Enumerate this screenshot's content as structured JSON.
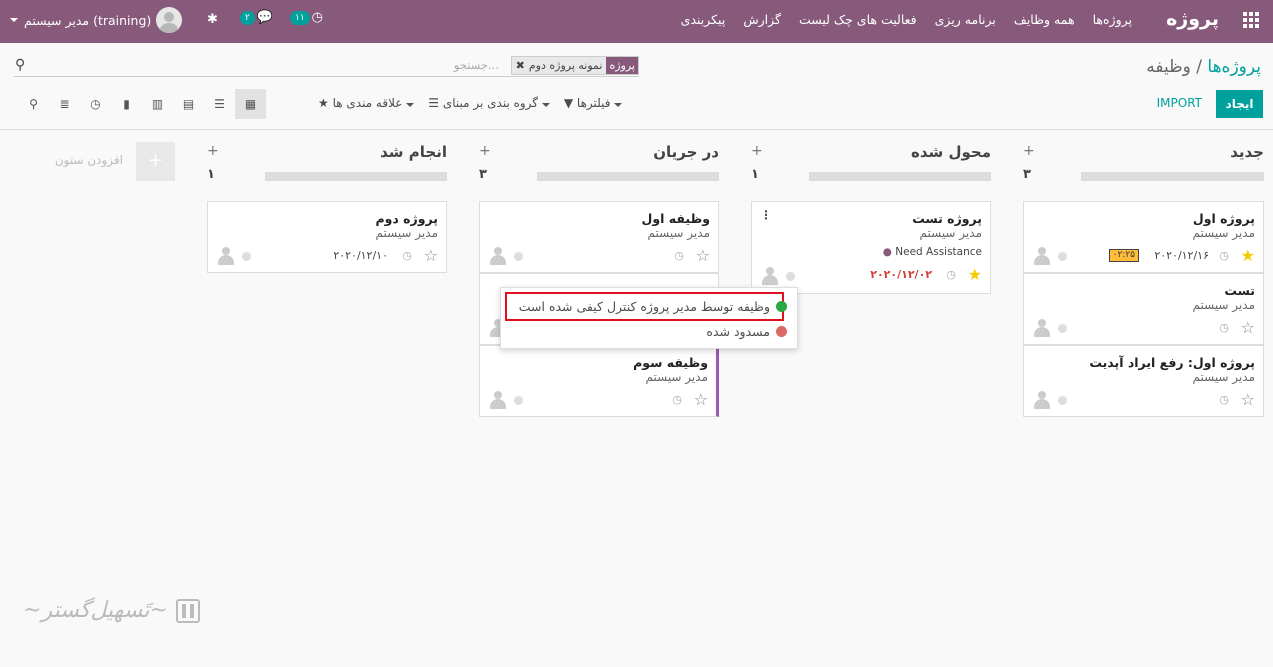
{
  "topbar": {
    "app_name": "پروژه",
    "menu": [
      "پروژه‌ها",
      "همه وظایف",
      "برنامه ریزی",
      "فعالیت های چک لیست",
      "گزارش",
      "پیکربندی"
    ],
    "user_name": "مدیر سیستم (training)",
    "chat_badge": "۲",
    "activity_badge": "۱۱"
  },
  "breadcrumb": {
    "parent": "پروژه‌ها",
    "separator": "/",
    "current": "وظیفه"
  },
  "search": {
    "facet_label": "پروژه",
    "facet_value": "نمونه پروژه دوم",
    "placeholder": "جستجو..."
  },
  "buttons": {
    "create": "ایجاد",
    "import": "IMPORT"
  },
  "filters": {
    "filter": "فیلترها",
    "group_by": "گروه بندی بر مبنای",
    "favorites": "علاقه مندی ها"
  },
  "columns": [
    {
      "title": "جدید",
      "count": "۳"
    },
    {
      "title": "محول شده",
      "count": "۱"
    },
    {
      "title": "در جریان",
      "count": "۳"
    },
    {
      "title": "انجام شد",
      "count": "۱"
    }
  ],
  "add_column": "افزودن ستون",
  "cards": {
    "new_1": {
      "title": "پروژه اول",
      "user": "مدیر سیستم",
      "date": "۲۰۲۰/۱۲/۱۶",
      "timer": "۰۲:۲۵"
    },
    "new_2": {
      "title": "تست",
      "user": "مدیر سیستم"
    },
    "new_3": {
      "title": "پروژه اول: رفع ایراد آپدیت",
      "user": "مدیر سیستم"
    },
    "assigned_1": {
      "title": "پروژه تست",
      "user": "مدیر سیستم",
      "tag": "Need Assistance",
      "date": "۲۰۲۰/۱۲/۰۲"
    },
    "prog_1": {
      "title": "وظیفه اول",
      "user": "مدیر سیستم"
    },
    "prog_3": {
      "title": "وظیفه سوم",
      "user": "مدیر سیستم"
    },
    "done_1": {
      "title": "پروژه دوم",
      "user": "مدیر سیستم",
      "date": "۲۰۲۰/۱۲/۱۰"
    }
  },
  "status_dropdown": {
    "ready": "وظیفه توسط مدیر پروژه کنترل کیفی شده است",
    "blocked": "مسدود شده",
    "ready_color": "#28a745",
    "blocked_color": "#dc6965"
  },
  "colors": {
    "brand": "#875a7b",
    "accent": "#00a09d"
  }
}
